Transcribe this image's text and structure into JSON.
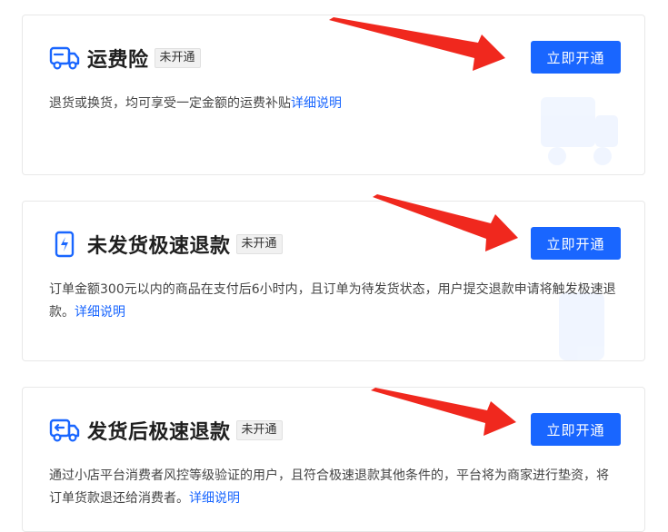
{
  "cards": [
    {
      "title": "运费险",
      "badge": "未开通",
      "button": "立即开通",
      "description": "退货或换货，均可享受一定金额的运费补贴",
      "link": "详细说明",
      "icon": "truck-icon"
    },
    {
      "title": "未发货极速退款",
      "badge": "未开通",
      "button": "立即开通",
      "description": "订单金额300元以内的商品在支付后6小时内，且订单为待发货状态，用户提交退款申请将触发极速退款。",
      "link": "详细说明",
      "icon": "phone-lightning-icon"
    },
    {
      "title": "发货后极速退款",
      "badge": "未开通",
      "button": "立即开通",
      "description": "通过小店平台消费者风控等级验证的用户，且符合极速退款其他条件的，平台将为商家进行垫资，将订单货款退还给消费者。",
      "link": "详细说明",
      "icon": "truck-return-icon"
    }
  ],
  "colors": {
    "accent": "#1966ff",
    "arrow": "#f0281e"
  }
}
